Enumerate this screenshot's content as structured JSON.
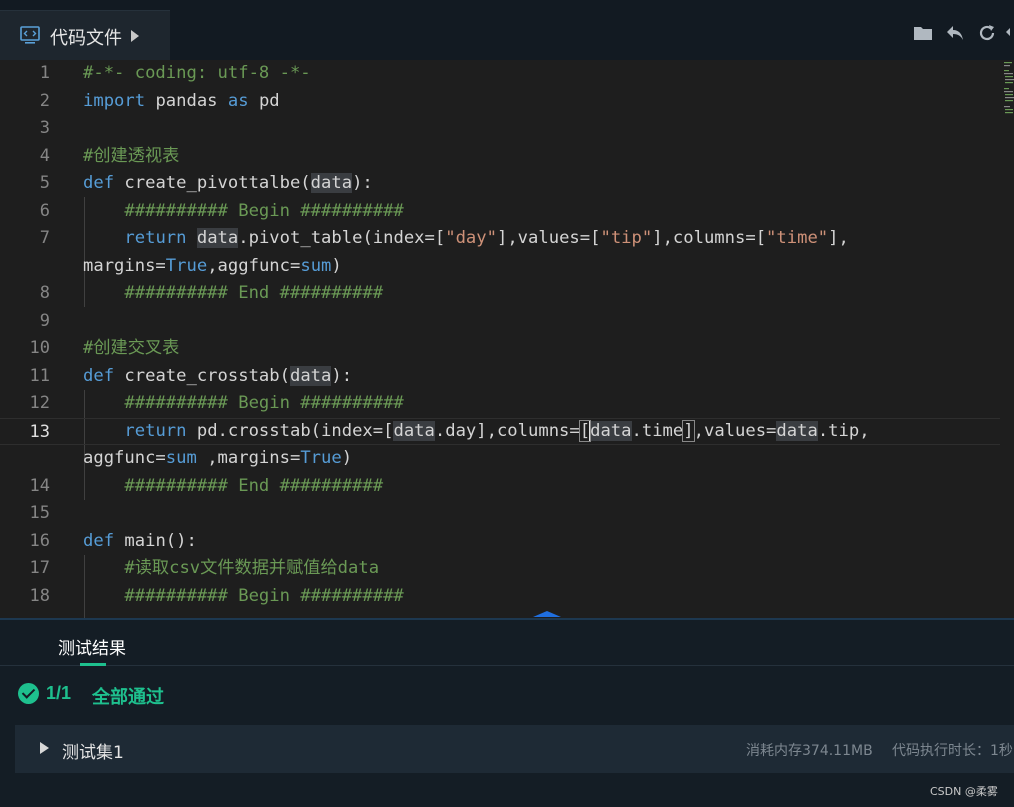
{
  "tab": {
    "title": "代码文件",
    "icon": "code-file-icon"
  },
  "toolbar": {
    "icons": [
      "folder-icon",
      "undo-icon",
      "refresh-icon",
      "download-icon"
    ]
  },
  "editor": {
    "active_line": 13,
    "lines": [
      {
        "n": "1",
        "text": "#-*- coding: utf-8 -*-"
      },
      {
        "n": "2",
        "text": "import pandas as pd"
      },
      {
        "n": "3",
        "text": ""
      },
      {
        "n": "4",
        "text": "#创建透视表"
      },
      {
        "n": "5",
        "text": "def create_pivottalbe(data):"
      },
      {
        "n": "6",
        "text": "    ########## Begin ##########"
      },
      {
        "n": "7",
        "text": "    return data.pivot_table(index=[\"day\"],values=[\"tip\"],columns=[\"time\"],",
        "wrap": "margins=True,aggfunc=sum)"
      },
      {
        "n": "8",
        "text": "    ########## End ##########"
      },
      {
        "n": "9",
        "text": ""
      },
      {
        "n": "10",
        "text": "#创建交叉表"
      },
      {
        "n": "11",
        "text": "def create_crosstab(data):"
      },
      {
        "n": "12",
        "text": "    ########## Begin ##########"
      },
      {
        "n": "13",
        "text": "    return pd.crosstab(index=[data.day],columns=[data.time],values=data.tip,",
        "wrap": "aggfunc=sum ,margins=True)"
      },
      {
        "n": "14",
        "text": "    ########## End ##########"
      },
      {
        "n": "15",
        "text": ""
      },
      {
        "n": "16",
        "text": "def main():"
      },
      {
        "n": "17",
        "text": "    #读取csv文件数据并赋值给data"
      },
      {
        "n": "18",
        "text": "    ########## Begin ##########"
      }
    ]
  },
  "results": {
    "tab_label": "测试结果",
    "count": "1/1",
    "status": "全部通过",
    "test_set": {
      "label": "测试集1",
      "memory": "消耗内存374.11MB",
      "time": "代码执行时长：1秒"
    }
  },
  "watermark": "CSDN @柔雾",
  "colors": {
    "keyword": "#569cd6",
    "comment": "#6a9955",
    "string": "#ce9178",
    "success": "#1ec08e"
  }
}
